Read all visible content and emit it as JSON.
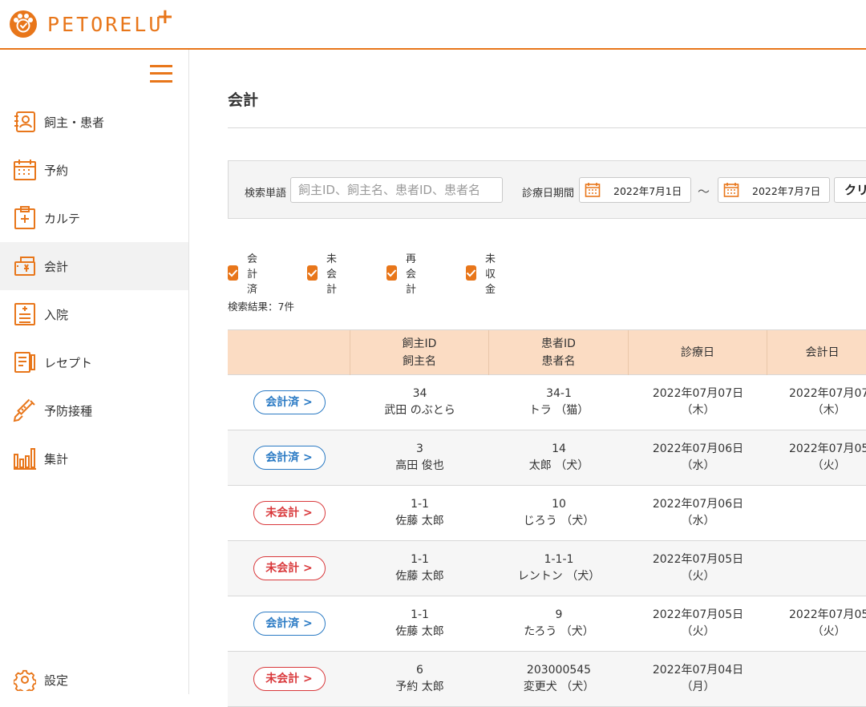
{
  "brand": {
    "name": "PETORELU",
    "plus": "+",
    "accent": "#e8761a"
  },
  "sidebar": {
    "items": [
      {
        "label": "飼主・患者",
        "icon": "owner-card-icon"
      },
      {
        "label": "予約",
        "icon": "calendar-icon"
      },
      {
        "label": "カルテ",
        "icon": "medical-chart-icon"
      },
      {
        "label": "会計",
        "icon": "register-icon",
        "active": true
      },
      {
        "label": "入院",
        "icon": "hospitalization-icon"
      },
      {
        "label": "レセプト",
        "icon": "receipt-icon"
      },
      {
        "label": "予防接種",
        "icon": "syringe-icon"
      },
      {
        "label": "集計",
        "icon": "bar-chart-icon"
      }
    ],
    "settings_label": "設定"
  },
  "page": {
    "title": "会計"
  },
  "search": {
    "keyword_label": "検索単語",
    "keyword_placeholder": "飼主ID、飼主名、患者ID、患者名",
    "period_label": "診療日期間",
    "date_from": "2022年7月1日",
    "tilde": "～",
    "date_to": "2022年7月7日",
    "clear_label": "クリ"
  },
  "filters": [
    {
      "label": "会計済",
      "checked": true
    },
    {
      "label": "未会計",
      "checked": true
    },
    {
      "label": "再会計",
      "checked": true
    },
    {
      "label": "未収金",
      "checked": true
    }
  ],
  "result_count": "検索結果：7件",
  "table": {
    "headers": {
      "owner": [
        "飼主ID",
        "飼主名"
      ],
      "patient": [
        "患者ID",
        "患者名"
      ],
      "visit_date": "診療日",
      "billing_date": "会計日"
    },
    "rows": [
      {
        "status": "会計済 >",
        "kind": "paid",
        "owner_id": "34",
        "owner_name": "武田 のぶとら",
        "patient_id": "34-1",
        "patient_name": "トラ （猫）",
        "visit_date": "2022年07月07日",
        "visit_dow": "（木）",
        "bill_date": "2022年07月07",
        "bill_dow": "（木）"
      },
      {
        "status": "会計済 >",
        "kind": "paid",
        "owner_id": "3",
        "owner_name": "高田 俊也",
        "patient_id": "14",
        "patient_name": "太郎 （犬）",
        "visit_date": "2022年07月06日",
        "visit_dow": "（水）",
        "bill_date": "2022年07月05",
        "bill_dow": "（火）"
      },
      {
        "status": "未会計 >",
        "kind": "unpaid",
        "owner_id": "1-1",
        "owner_name": "佐藤 太郎",
        "patient_id": "10",
        "patient_name": "じろう （犬）",
        "visit_date": "2022年07月06日",
        "visit_dow": "（水）",
        "bill_date": "",
        "bill_dow": ""
      },
      {
        "status": "未会計 >",
        "kind": "unpaid",
        "owner_id": "1-1",
        "owner_name": "佐藤 太郎",
        "patient_id": "1-1-1",
        "patient_name": "レントン （犬）",
        "visit_date": "2022年07月05日",
        "visit_dow": "（火）",
        "bill_date": "",
        "bill_dow": ""
      },
      {
        "status": "会計済 >",
        "kind": "paid",
        "owner_id": "1-1",
        "owner_name": "佐藤 太郎",
        "patient_id": "9",
        "patient_name": "たろう （犬）",
        "visit_date": "2022年07月05日",
        "visit_dow": "（火）",
        "bill_date": "2022年07月05",
        "bill_dow": "（火）"
      },
      {
        "status": "未会計 >",
        "kind": "unpaid",
        "owner_id": "6",
        "owner_name": "予約 太郎",
        "patient_id": "203000545",
        "patient_name": "変更犬 （犬）",
        "visit_date": "2022年07月04日",
        "visit_dow": "（月）",
        "bill_date": "",
        "bill_dow": ""
      }
    ]
  }
}
